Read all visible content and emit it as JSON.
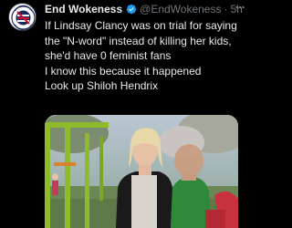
{
  "tweet": {
    "author": {
      "display_name": "End Wokeness",
      "handle": "@EndWokeness",
      "verified": true,
      "verified_color": "#1d9bf0",
      "avatar_text": "END WOKENESS"
    },
    "separator": "·",
    "timestamp": "5h",
    "more_icon": "ellipsis-icon",
    "text_paragraphs": [
      "If Lindsay Clancy was on trial for saying the \"N-word\" instead of killing her kids, she'd have 0 feminist fans",
      "I know this because it happened",
      "Look up Shiloh Hendrix"
    ],
    "media": {
      "description": "Photo of a woman holding a child at a playground"
    }
  },
  "colors": {
    "background": "#000000",
    "primary_text": "#e7e9ea",
    "secondary_text": "#71767b",
    "accent": "#1d9bf0"
  }
}
